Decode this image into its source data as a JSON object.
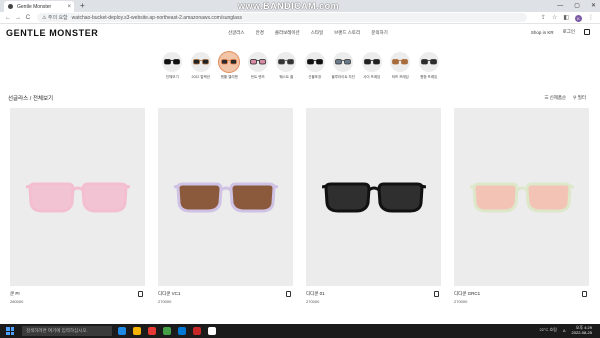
{
  "browser": {
    "tab_title": "Gentle Monster",
    "tab_close": "×",
    "newtab": "+",
    "win_min": "—",
    "win_max": "▢",
    "win_close": "✕",
    "watermark": "www.BANDICAM.com",
    "back": "←",
    "forward": "→",
    "reload": "C",
    "lock_label": "⚠ 주의 요함",
    "url": "watchao-bucket-deploy.s3-website.ap-northeast-2.amazonaws.com/sunglass",
    "profile": "K",
    "icons": [
      "share-icon",
      "star-icon",
      "extension-icon"
    ]
  },
  "site": {
    "logo": "GENTLE MONSTER",
    "nav": [
      "선글라스",
      "안경",
      "콜라보레이션",
      "스타일",
      "브랜드 스토리",
      "문의하기"
    ],
    "shop_in": "Shop in KR",
    "login": "로그인"
  },
  "categories": [
    {
      "label": "전체보기",
      "lens": "#111111",
      "frame": "#111111"
    },
    {
      "label": "2022 컬렉션",
      "lens": "#222222",
      "frame": "#a06a3b"
    },
    {
      "label": "젠틀 젤리젠",
      "lens": "#2b2b2b",
      "frame": "#e07b46"
    },
    {
      "label": "틴트 렌즈",
      "lens": "#d88ca7",
      "frame": "#222222"
    },
    {
      "label": "웨스트 쿨",
      "lens": "#333333",
      "frame": "#444444"
    },
    {
      "label": "선물포장",
      "lens": "#111111",
      "frame": "#111111"
    },
    {
      "label": "블루라이트 차단",
      "lens": "#6a7a8a",
      "frame": "#333333"
    },
    {
      "label": "사이 프레임",
      "lens": "#222222",
      "frame": "#222222"
    },
    {
      "label": "하프 프레임",
      "lens": "#a86b3b",
      "frame": "#a86b3b"
    },
    {
      "label": "원형 프레임",
      "lens": "#2d2d2d",
      "frame": "#2d2d2d"
    }
  ],
  "breadcrumb": "선글라스 / 전체보기",
  "tools": {
    "sort": "☰ 신제품순",
    "filter": "⚲ 필터"
  },
  "products": [
    {
      "name": "쿤 PI",
      "price": "280000",
      "frame_color": "#f3bfd0",
      "lens_color": "#f2c3d3"
    },
    {
      "name": "디디쿤 VC1",
      "price": "270000",
      "frame_color": "#cfc2e4",
      "lens_color": "#8b5a3d"
    },
    {
      "name": "디디쿤 01",
      "price": "270000",
      "frame_color": "#111111",
      "lens_color": "#2f2f2f"
    },
    {
      "name": "디디쿤 GRC1",
      "price": "270000",
      "frame_color": "#dde7c9",
      "lens_color": "#f3c3b6"
    }
  ],
  "taskbar": {
    "search_placeholder": "검색하려면 여기에 입력하십시오.",
    "weather": "22°C 흐림",
    "lang": "A",
    "time": "오후 4:29",
    "date": "2022-08-25",
    "apps": [
      "#1e88e5",
      "#f5b400",
      "#e53935",
      "#43a047",
      "#0078d4",
      "#c62828",
      "#ffffff"
    ]
  }
}
